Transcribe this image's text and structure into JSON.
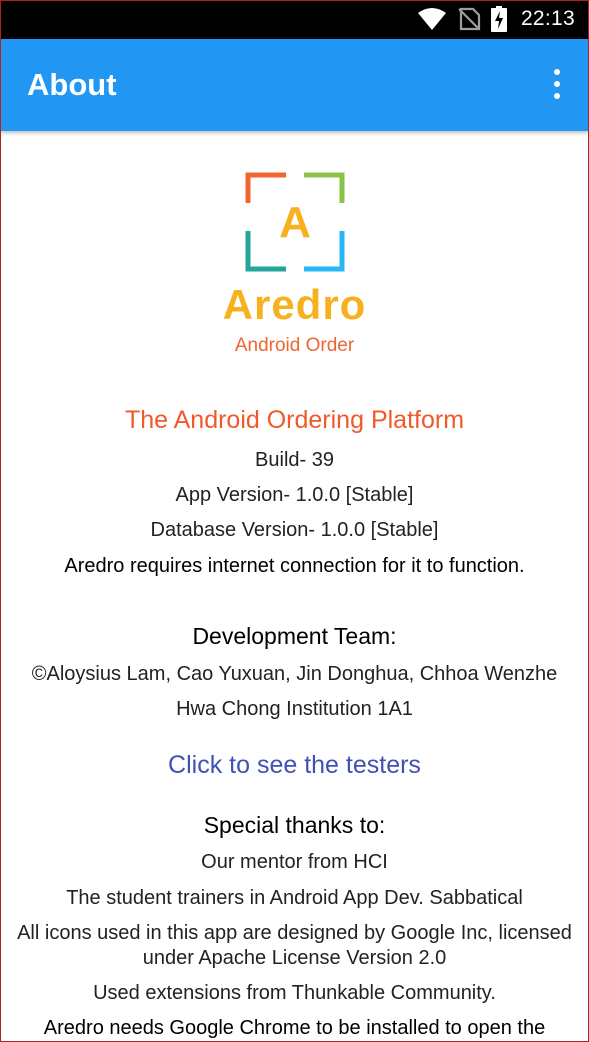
{
  "status_bar": {
    "time": "22:13",
    "icons": [
      "wifi-icon",
      "no-sim-icon",
      "battery-charging-icon"
    ]
  },
  "app_bar": {
    "title": "About",
    "menu_icon": "more-vert-icon",
    "color": "#2196f3"
  },
  "logo": {
    "letter": "A",
    "wordmark": "Aredro",
    "subtitle": "Android Order",
    "colors": {
      "orange": "#ef6630",
      "green": "#8bc34a",
      "blue": "#29b6f6",
      "yellow": "#f7b11e"
    }
  },
  "info": {
    "tagline": "The Android Ordering Platform",
    "build": "Build- 39",
    "app_version": "App Version- 1.0.0 [Stable]",
    "db_version": "Database Version- 1.0.0 [Stable]",
    "internet_note": "Aredro requires internet connection for it to function."
  },
  "team": {
    "heading": "Development Team:",
    "members": "©Aloysius Lam, Cao Yuxuan, Jin Donghua, Chhoa Wenzhe",
    "institution": "Hwa Chong Institution 1A1"
  },
  "testers_link": "Click to see the testers",
  "thanks": {
    "heading": "Special thanks to:",
    "mentor": "Our mentor from HCI",
    "trainers": "The student trainers in Android App Dev. Sabbatical",
    "icons_license": "All icons used in this app are designed by Google Inc, licensed under Apache License Version 2.0",
    "extensions": "Used extensions from Thunkable Community.",
    "chrome_note": "Aredro needs Google Chrome to be installed to open the"
  }
}
